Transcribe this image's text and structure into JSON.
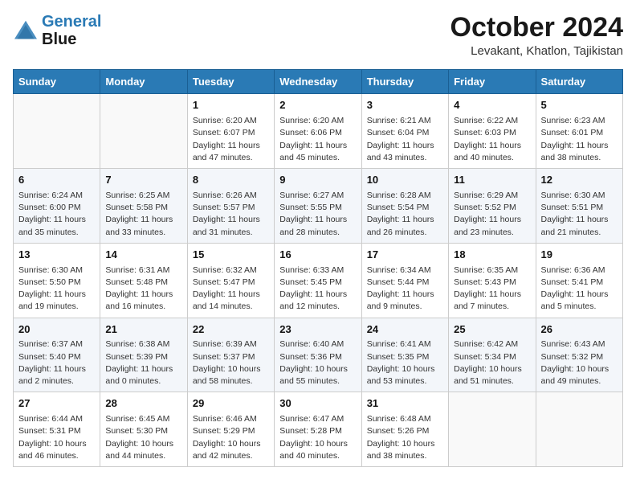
{
  "header": {
    "logo_line1": "General",
    "logo_line2": "Blue",
    "month_year": "October 2024",
    "location": "Levakant, Khatlon, Tajikistan"
  },
  "days_of_week": [
    "Sunday",
    "Monday",
    "Tuesday",
    "Wednesday",
    "Thursday",
    "Friday",
    "Saturday"
  ],
  "weeks": [
    [
      {
        "num": "",
        "sunrise": "",
        "sunset": "",
        "daylight": ""
      },
      {
        "num": "",
        "sunrise": "",
        "sunset": "",
        "daylight": ""
      },
      {
        "num": "1",
        "sunrise": "Sunrise: 6:20 AM",
        "sunset": "Sunset: 6:07 PM",
        "daylight": "Daylight: 11 hours and 47 minutes."
      },
      {
        "num": "2",
        "sunrise": "Sunrise: 6:20 AM",
        "sunset": "Sunset: 6:06 PM",
        "daylight": "Daylight: 11 hours and 45 minutes."
      },
      {
        "num": "3",
        "sunrise": "Sunrise: 6:21 AM",
        "sunset": "Sunset: 6:04 PM",
        "daylight": "Daylight: 11 hours and 43 minutes."
      },
      {
        "num": "4",
        "sunrise": "Sunrise: 6:22 AM",
        "sunset": "Sunset: 6:03 PM",
        "daylight": "Daylight: 11 hours and 40 minutes."
      },
      {
        "num": "5",
        "sunrise": "Sunrise: 6:23 AM",
        "sunset": "Sunset: 6:01 PM",
        "daylight": "Daylight: 11 hours and 38 minutes."
      }
    ],
    [
      {
        "num": "6",
        "sunrise": "Sunrise: 6:24 AM",
        "sunset": "Sunset: 6:00 PM",
        "daylight": "Daylight: 11 hours and 35 minutes."
      },
      {
        "num": "7",
        "sunrise": "Sunrise: 6:25 AM",
        "sunset": "Sunset: 5:58 PM",
        "daylight": "Daylight: 11 hours and 33 minutes."
      },
      {
        "num": "8",
        "sunrise": "Sunrise: 6:26 AM",
        "sunset": "Sunset: 5:57 PM",
        "daylight": "Daylight: 11 hours and 31 minutes."
      },
      {
        "num": "9",
        "sunrise": "Sunrise: 6:27 AM",
        "sunset": "Sunset: 5:55 PM",
        "daylight": "Daylight: 11 hours and 28 minutes."
      },
      {
        "num": "10",
        "sunrise": "Sunrise: 6:28 AM",
        "sunset": "Sunset: 5:54 PM",
        "daylight": "Daylight: 11 hours and 26 minutes."
      },
      {
        "num": "11",
        "sunrise": "Sunrise: 6:29 AM",
        "sunset": "Sunset: 5:52 PM",
        "daylight": "Daylight: 11 hours and 23 minutes."
      },
      {
        "num": "12",
        "sunrise": "Sunrise: 6:30 AM",
        "sunset": "Sunset: 5:51 PM",
        "daylight": "Daylight: 11 hours and 21 minutes."
      }
    ],
    [
      {
        "num": "13",
        "sunrise": "Sunrise: 6:30 AM",
        "sunset": "Sunset: 5:50 PM",
        "daylight": "Daylight: 11 hours and 19 minutes."
      },
      {
        "num": "14",
        "sunrise": "Sunrise: 6:31 AM",
        "sunset": "Sunset: 5:48 PM",
        "daylight": "Daylight: 11 hours and 16 minutes."
      },
      {
        "num": "15",
        "sunrise": "Sunrise: 6:32 AM",
        "sunset": "Sunset: 5:47 PM",
        "daylight": "Daylight: 11 hours and 14 minutes."
      },
      {
        "num": "16",
        "sunrise": "Sunrise: 6:33 AM",
        "sunset": "Sunset: 5:45 PM",
        "daylight": "Daylight: 11 hours and 12 minutes."
      },
      {
        "num": "17",
        "sunrise": "Sunrise: 6:34 AM",
        "sunset": "Sunset: 5:44 PM",
        "daylight": "Daylight: 11 hours and 9 minutes."
      },
      {
        "num": "18",
        "sunrise": "Sunrise: 6:35 AM",
        "sunset": "Sunset: 5:43 PM",
        "daylight": "Daylight: 11 hours and 7 minutes."
      },
      {
        "num": "19",
        "sunrise": "Sunrise: 6:36 AM",
        "sunset": "Sunset: 5:41 PM",
        "daylight": "Daylight: 11 hours and 5 minutes."
      }
    ],
    [
      {
        "num": "20",
        "sunrise": "Sunrise: 6:37 AM",
        "sunset": "Sunset: 5:40 PM",
        "daylight": "Daylight: 11 hours and 2 minutes."
      },
      {
        "num": "21",
        "sunrise": "Sunrise: 6:38 AM",
        "sunset": "Sunset: 5:39 PM",
        "daylight": "Daylight: 11 hours and 0 minutes."
      },
      {
        "num": "22",
        "sunrise": "Sunrise: 6:39 AM",
        "sunset": "Sunset: 5:37 PM",
        "daylight": "Daylight: 10 hours and 58 minutes."
      },
      {
        "num": "23",
        "sunrise": "Sunrise: 6:40 AM",
        "sunset": "Sunset: 5:36 PM",
        "daylight": "Daylight: 10 hours and 55 minutes."
      },
      {
        "num": "24",
        "sunrise": "Sunrise: 6:41 AM",
        "sunset": "Sunset: 5:35 PM",
        "daylight": "Daylight: 10 hours and 53 minutes."
      },
      {
        "num": "25",
        "sunrise": "Sunrise: 6:42 AM",
        "sunset": "Sunset: 5:34 PM",
        "daylight": "Daylight: 10 hours and 51 minutes."
      },
      {
        "num": "26",
        "sunrise": "Sunrise: 6:43 AM",
        "sunset": "Sunset: 5:32 PM",
        "daylight": "Daylight: 10 hours and 49 minutes."
      }
    ],
    [
      {
        "num": "27",
        "sunrise": "Sunrise: 6:44 AM",
        "sunset": "Sunset: 5:31 PM",
        "daylight": "Daylight: 10 hours and 46 minutes."
      },
      {
        "num": "28",
        "sunrise": "Sunrise: 6:45 AM",
        "sunset": "Sunset: 5:30 PM",
        "daylight": "Daylight: 10 hours and 44 minutes."
      },
      {
        "num": "29",
        "sunrise": "Sunrise: 6:46 AM",
        "sunset": "Sunset: 5:29 PM",
        "daylight": "Daylight: 10 hours and 42 minutes."
      },
      {
        "num": "30",
        "sunrise": "Sunrise: 6:47 AM",
        "sunset": "Sunset: 5:28 PM",
        "daylight": "Daylight: 10 hours and 40 minutes."
      },
      {
        "num": "31",
        "sunrise": "Sunrise: 6:48 AM",
        "sunset": "Sunset: 5:26 PM",
        "daylight": "Daylight: 10 hours and 38 minutes."
      },
      {
        "num": "",
        "sunrise": "",
        "sunset": "",
        "daylight": ""
      },
      {
        "num": "",
        "sunrise": "",
        "sunset": "",
        "daylight": ""
      }
    ]
  ]
}
